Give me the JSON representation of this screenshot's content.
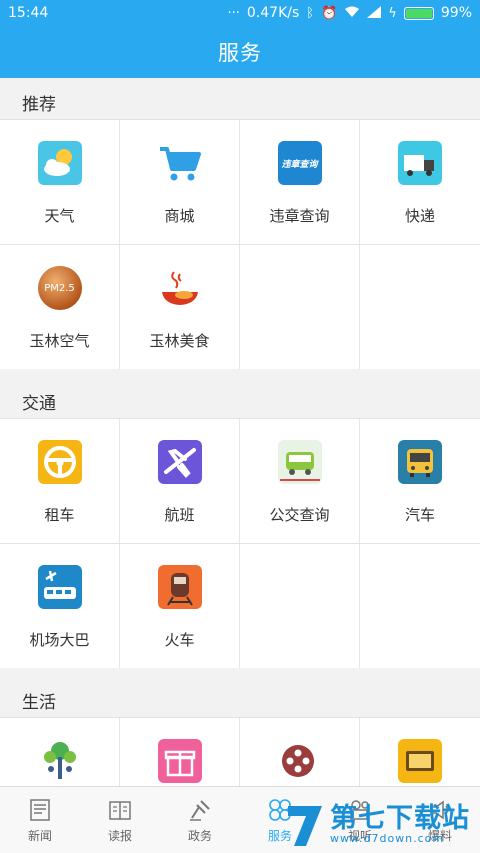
{
  "status_bar": {
    "time": "15:44",
    "network_speed": "0.47K/s",
    "battery": "99%"
  },
  "header": {
    "title": "服务"
  },
  "sections": [
    {
      "title": "推荐",
      "items": [
        {
          "label": "天气",
          "icon": "weather-icon"
        },
        {
          "label": "商城",
          "icon": "shopping-cart-icon"
        },
        {
          "label": "违章查询",
          "icon": "violation-query-icon",
          "icon_text": "违章查询"
        },
        {
          "label": "快递",
          "icon": "delivery-truck-icon"
        },
        {
          "label": "玉林空气",
          "icon": "air-quality-icon",
          "icon_text": "PM2.5"
        },
        {
          "label": "玉林美食",
          "icon": "food-bowl-icon"
        }
      ]
    },
    {
      "title": "交通",
      "items": [
        {
          "label": "租车",
          "icon": "steering-wheel-icon"
        },
        {
          "label": "航班",
          "icon": "airplane-icon"
        },
        {
          "label": "公交查询",
          "icon": "bus-query-icon"
        },
        {
          "label": "汽车",
          "icon": "coach-bus-icon"
        },
        {
          "label": "机场大巴",
          "icon": "airport-bus-icon"
        },
        {
          "label": "火车",
          "icon": "train-icon"
        }
      ]
    },
    {
      "title": "生活",
      "items": [
        {
          "label": "",
          "icon": "tree-people-icon"
        },
        {
          "label": "",
          "icon": "gift-icon"
        },
        {
          "label": "",
          "icon": "film-reel-icon"
        },
        {
          "label": "",
          "icon": "tv-icon"
        }
      ]
    }
  ],
  "tabs": [
    {
      "label": "新闻",
      "icon": "news-icon"
    },
    {
      "label": "读报",
      "icon": "newspaper-icon"
    },
    {
      "label": "政务",
      "icon": "gavel-icon"
    },
    {
      "label": "服务",
      "icon": "services-icon",
      "active": true
    },
    {
      "label": "视听",
      "icon": "media-icon"
    },
    {
      "label": "爆料",
      "icon": "tipoff-icon"
    }
  ],
  "watermark": {
    "text": "第七下载站",
    "url": "www.d7down.com"
  },
  "colors": {
    "primary": "#29aaf0",
    "background": "#f2f2f2",
    "text": "#333333"
  }
}
